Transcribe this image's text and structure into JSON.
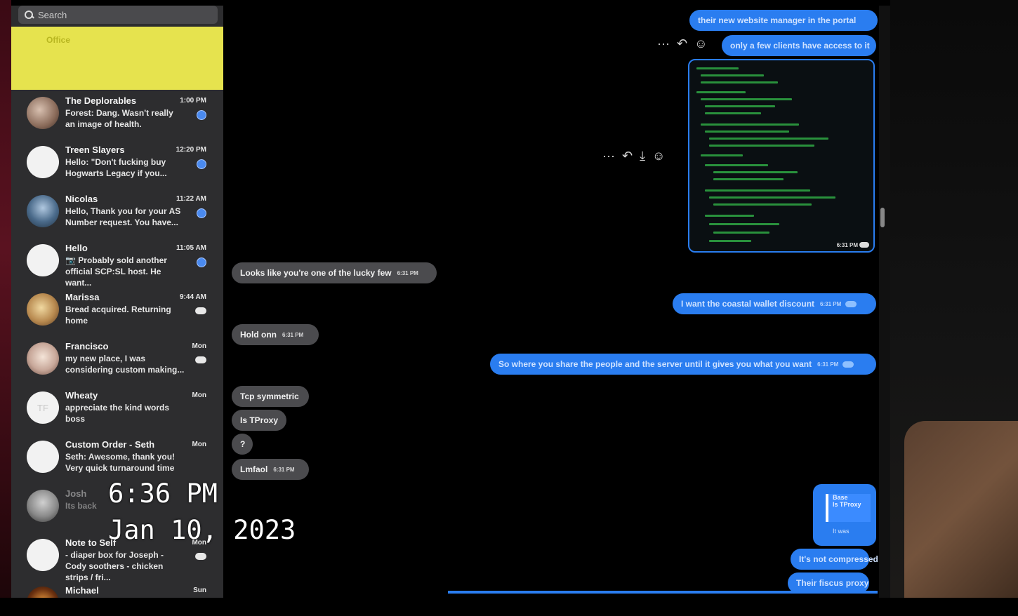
{
  "search": {
    "placeholder": "Search"
  },
  "pinned": {
    "title": "Office",
    "lines": [
      "",
      ""
    ]
  },
  "conversations": [
    {
      "name": "The Deplorables",
      "time": "1:00 PM",
      "preview": "Forest: Dang. Wasn't really an image of health.",
      "unread": true
    },
    {
      "name": "Treen Slayers",
      "time": "12:20 PM",
      "preview": "Hello: \"Don't fucking buy Hogwarts Legacy if you...",
      "unread": true
    },
    {
      "name": "Nicolas",
      "time": "11:22 AM",
      "preview": "Hello, Thank you for your AS Number request. You have...",
      "unread": true
    },
    {
      "name": "Hello",
      "time": "11:05 AM",
      "preview": "📷 Probably sold another official SCP:SL host. He want...",
      "unread": true
    },
    {
      "name": "Marissa",
      "time": "9:44 AM",
      "preview": "Bread acquired. Returning home",
      "unread": false
    },
    {
      "name": "Francisco",
      "time": "Mon",
      "preview": "my new place, I was considering custom making...",
      "unread": false
    },
    {
      "name": "Wheaty",
      "time": "Mon",
      "preview": "appreciate the kind words boss",
      "unread": false,
      "initials": "TF"
    },
    {
      "name": "Custom Order - Seth",
      "time": "Mon",
      "preview": "Seth: Awesome, thank you! Very quick turnaround time",
      "unread": false
    },
    {
      "name": "Josh",
      "time": "",
      "preview": "Its back",
      "unread": false
    },
    {
      "name": "Note to Self",
      "time": "Mon",
      "preview": "- diaper box for Joseph - Cody soothers - chicken strips / fri...",
      "unread": false
    },
    {
      "name": "Michael",
      "time": "Sun",
      "preview": "",
      "unread": false
    }
  ],
  "messages": {
    "out1": "their new website manager in the portal",
    "out2": "only a few clients have access to it",
    "image_time": "6:31 PM",
    "in1": "Looks like you're one of the lucky few",
    "in1_time": "6:31 PM",
    "out3": "I want the coastal wallet discount",
    "out3_time": "6:31 PM",
    "in2": "Hold onn",
    "in2_time": "6:31 PM",
    "out4": "So where you share the people and the server until it gives you what you want",
    "out4_time": "6:31 PM",
    "in3": "Tcp symmetric",
    "in4": "Is TProxy",
    "in5": "?",
    "in6": "Lmfaol",
    "in6_time": "6:31 PM",
    "card_title": "Base",
    "card_sub1": "Is TProxy",
    "card_sub2": "It was",
    "out5": "It's not compressed",
    "out6": "Their fiscus proxy"
  },
  "actions": {
    "more": "···",
    "reply": "↶",
    "download": "⤓",
    "react": "☺"
  },
  "overlay": {
    "time": "6:36 PM",
    "date": "Jan 10, 2023"
  },
  "colors": {
    "accent": "#2a7df0",
    "incoming": "#4b4b4e",
    "pinned": "#e6e34e",
    "sidebar": "#2d2d2f"
  }
}
